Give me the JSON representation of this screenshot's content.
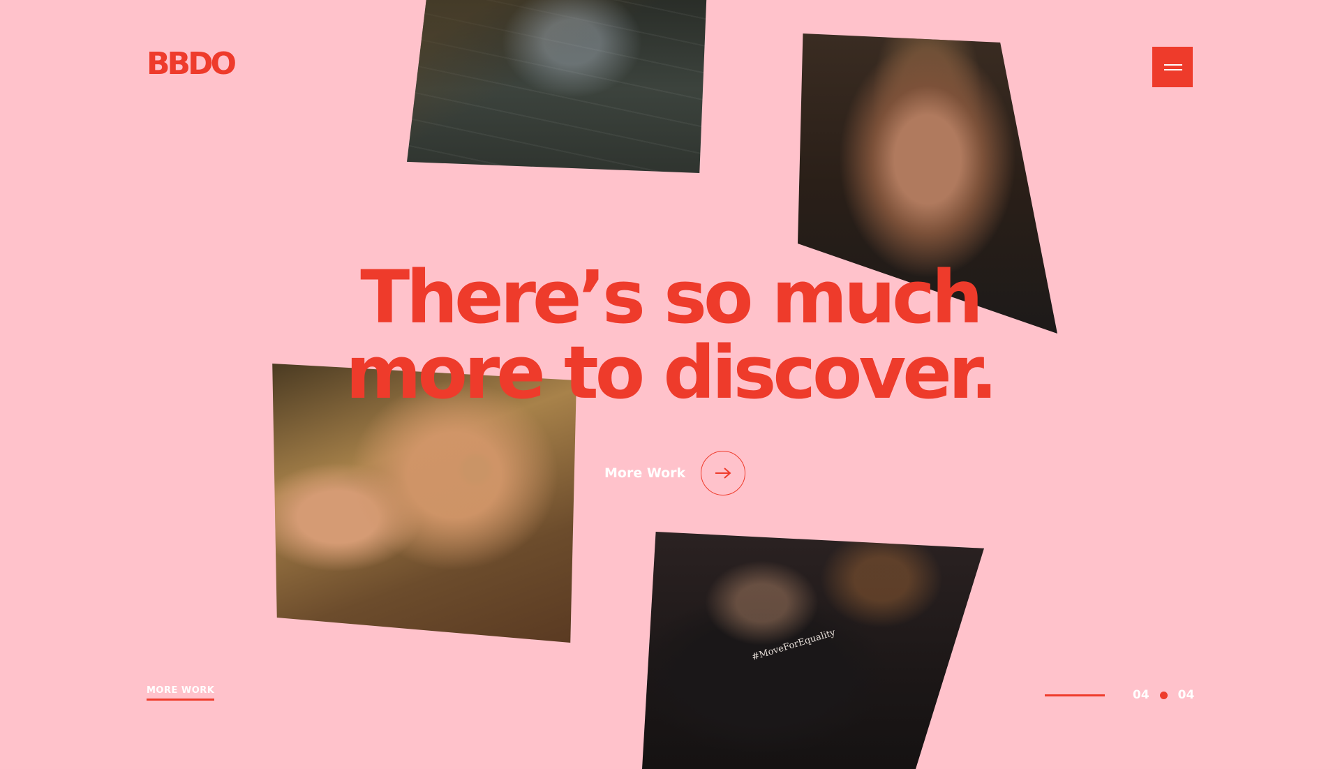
{
  "brand": {
    "logo_text": "BBDO"
  },
  "menu": {
    "icon": "hamburger-icon"
  },
  "hero": {
    "line1": "There’s so much",
    "line2": "more to discover."
  },
  "cta": {
    "label": "More Work",
    "icon": "arrow-right-icon"
  },
  "footer": {
    "link_label": "MORE WORK"
  },
  "pager": {
    "current": "04",
    "total": "04"
  },
  "gallery": {
    "gym_shirt_text": "#MoveForEquality"
  },
  "colors": {
    "accent": "#ee3b2b",
    "background": "#ffc2cb",
    "text_light": "#ffffff"
  }
}
